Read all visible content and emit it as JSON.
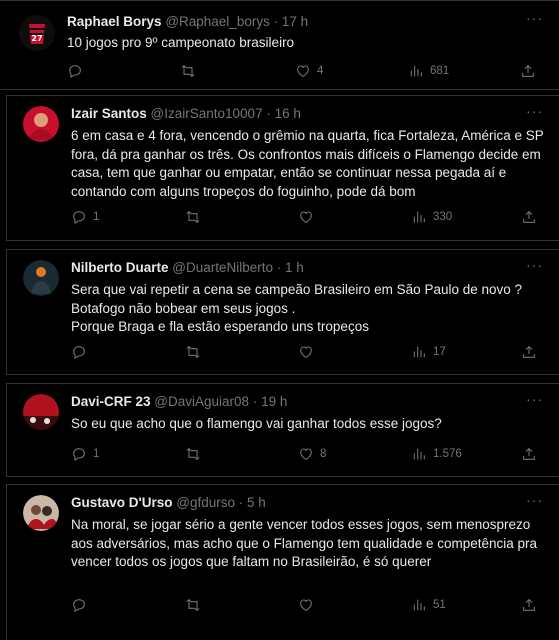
{
  "tweets": [
    {
      "name": "Raphael Borys",
      "handle": "@Raphael_borys",
      "time": "· 17 h",
      "text": "10 jogos pro 9º campeonato brasileiro",
      "replies": "",
      "retweets": "",
      "likes": "4",
      "views": "681",
      "avatar_color": "#c8102e"
    },
    {
      "name": "Izair Santos",
      "handle": "@IzairSanto10007",
      "time": "· 16 h",
      "text": "6 em casa e 4 fora, vencendo o grêmio na quarta, fica Fortaleza, América e SP fora, dá pra ganhar os três. Os confrontos mais difíceis o Flamengo decide em casa, tem que ganhar ou empatar, então se continuar nessa pegada aí e contando com alguns tropeços do foguinho, pode dá bom",
      "replies": "1",
      "retweets": "",
      "likes": "",
      "views": "330",
      "avatar_color": "#d9a07a"
    },
    {
      "name": "Nilberto Duarte",
      "handle": "@DuarteNilberto",
      "time": "· 1 h",
      "text": "Sera que vai repetir a cena se campeão Brasileiro  em São Paulo de novo ? Botafogo não bobear em seus jogos .\nPorque Braga e fla estão esperando uns tropeços",
      "replies": "",
      "retweets": "",
      "likes": "",
      "views": "17",
      "avatar_color": "#1a2a33"
    },
    {
      "name": "Davi-CRF 23",
      "handle": "@DaviAguiar08",
      "time": "· 19 h",
      "text": "So eu que acho que o flamengo vai ganhar todos esse jogos?",
      "replies": "1",
      "retweets": "",
      "likes": "8",
      "views": "1.576",
      "avatar_color": "#b0131e"
    },
    {
      "name": "Gustavo D'Urso",
      "handle": "@gfdurso",
      "time": "· 5 h",
      "text": "Na moral, se jogar sério a gente vencer todos esses jogos, sem menosprezo aos adversários, mas acho que o Flamengo tem qualidade e competência pra vencer todos os jogos que faltam no Brasileirão, é só querer",
      "replies": "",
      "retweets": "",
      "likes": "",
      "views": "51",
      "avatar_color": "#6b4a3a"
    }
  ],
  "more_label": "···",
  "icons": [
    "reply-icon",
    "retweet-icon",
    "like-icon",
    "views-icon",
    "share-icon",
    "more-icon"
  ]
}
